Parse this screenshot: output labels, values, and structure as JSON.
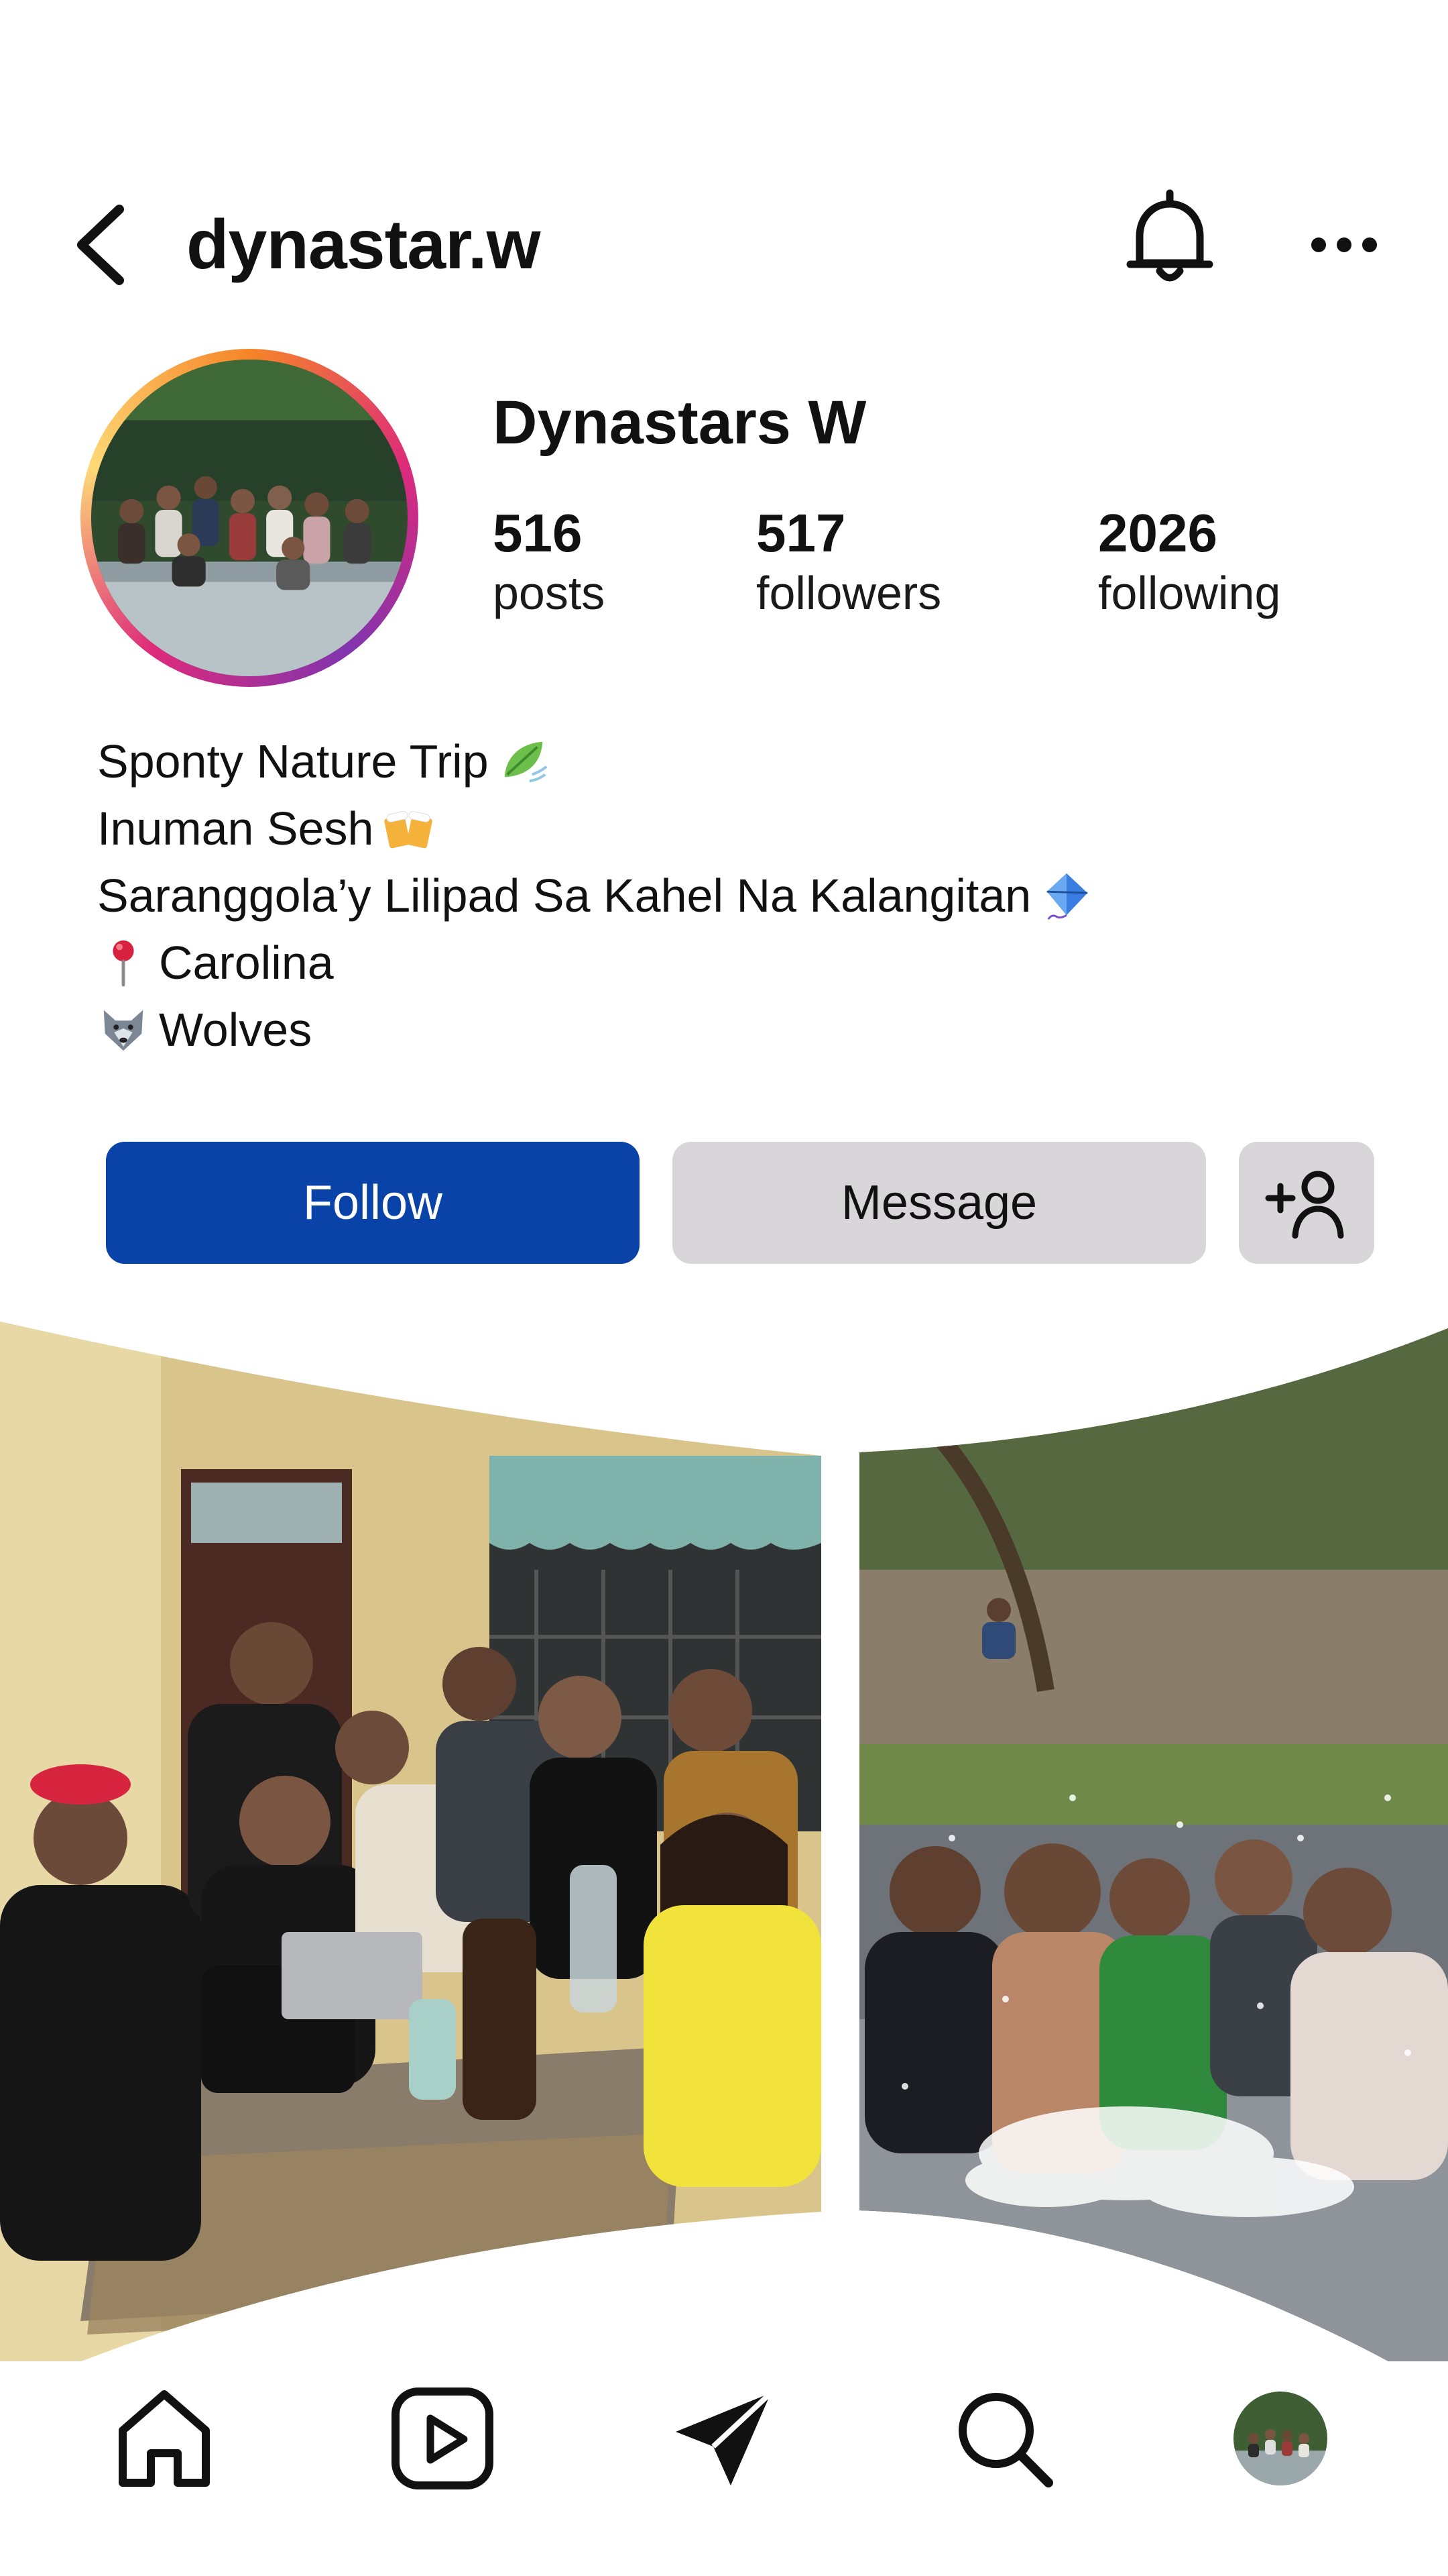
{
  "header": {
    "username": "dynastar.w",
    "icons": {
      "back": "back-chevron-icon",
      "notifications": "bell-icon",
      "more": "more-horizontal-icon"
    }
  },
  "profile": {
    "display_name": "Dynastars W",
    "avatar_icon": "profile-avatar-photo",
    "story_ring_colors": [
      "#f58529",
      "#dd2a7b",
      "#8134af"
    ],
    "stats": [
      {
        "value": "516",
        "label": "posts"
      },
      {
        "value": "517",
        "label": "followers"
      },
      {
        "value": "2026",
        "label": "following"
      }
    ],
    "bio": [
      {
        "text": "Sponty Nature Trip",
        "icon": "leaf-wind-icon"
      },
      {
        "text": "Inuman Sesh",
        "icon": "beer-mugs-icon"
      },
      {
        "text": "Saranggola’y Lilipad Sa Kahel Na Kalangitan",
        "icon": "kite-icon"
      },
      {
        "text": "Carolina",
        "icon": "round-pushpin-icon"
      },
      {
        "text": "Wolves",
        "icon": "wolf-icon"
      }
    ]
  },
  "actions": {
    "follow_label": "Follow",
    "message_label": "Message",
    "add_user_icon": "add-person-icon",
    "colors": {
      "follow_bg": "#0a43a8",
      "secondary_bg": "#d9d6d9"
    }
  },
  "posts": [
    {
      "icon": "group-photo-indoor"
    },
    {
      "icon": "group-photo-river"
    }
  ],
  "bottom_nav": {
    "items": [
      {
        "id": "home",
        "icon": "home-icon"
      },
      {
        "id": "reels",
        "icon": "reels-icon"
      },
      {
        "id": "direct",
        "icon": "paper-plane-icon"
      },
      {
        "id": "search",
        "icon": "search-icon"
      },
      {
        "id": "profile",
        "icon": "profile-avatar-icon"
      }
    ]
  }
}
